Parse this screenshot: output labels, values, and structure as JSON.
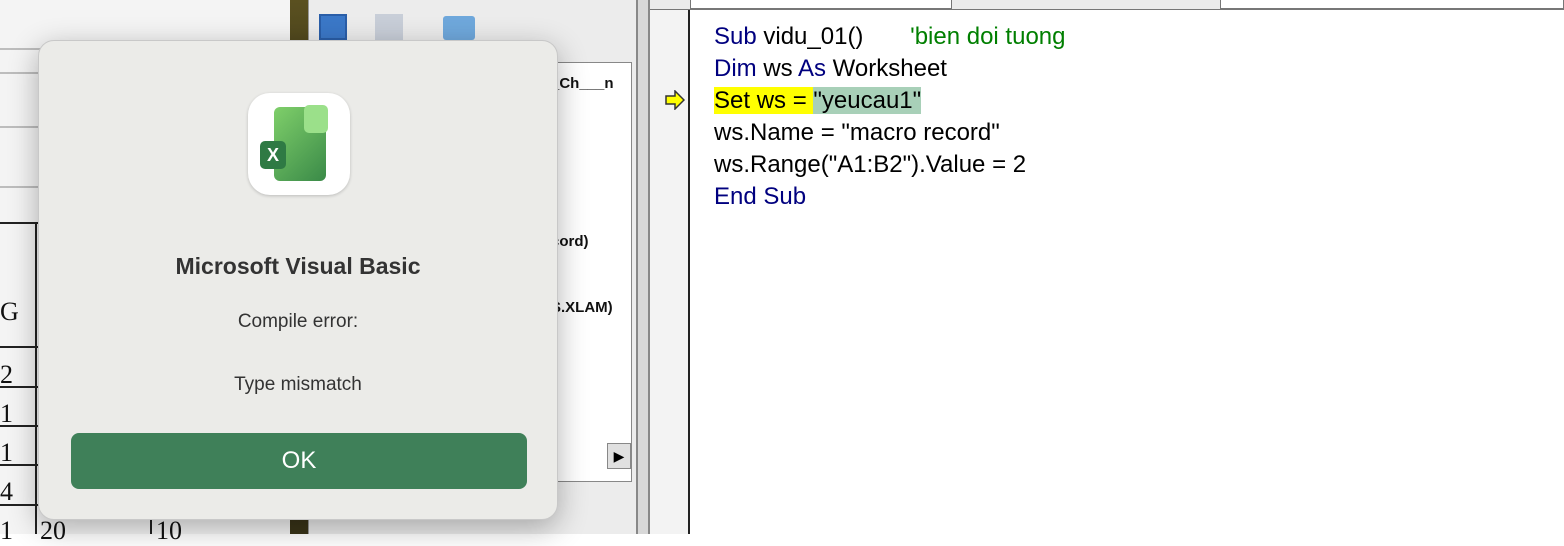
{
  "spreadsheet": {
    "column_header": "G",
    "cells": [
      "2",
      "1",
      "1",
      "4",
      "1",
      "20",
      "10"
    ]
  },
  "project_pane": {
    "items": [
      "_Ch___n",
      "cord)",
      "S.XLAM)"
    ]
  },
  "code": {
    "lines": [
      {
        "parts": [
          {
            "t": "Sub",
            "c": "kw"
          },
          {
            "t": " vidu_01()       ",
            "c": ""
          },
          {
            "t": "'bien doi tuong",
            "c": "cm"
          }
        ]
      },
      {
        "parts": [
          {
            "t": "Dim",
            "c": "kw"
          },
          {
            "t": " ws ",
            "c": ""
          },
          {
            "t": "As",
            "c": "kw"
          },
          {
            "t": " Worksheet",
            "c": ""
          }
        ]
      },
      {
        "parts": [
          {
            "t": "Set ws = ",
            "c": "yl"
          },
          {
            "t": "\"yeucau1\"",
            "c": "sel"
          }
        ]
      },
      {
        "parts": [
          {
            "t": "ws.Name = \"macro record\"",
            "c": ""
          }
        ]
      },
      {
        "parts": [
          {
            "t": "ws.Range(\"A1:B2\").Value = 2",
            "c": ""
          }
        ]
      },
      {
        "parts": [
          {
            "t": "End Sub",
            "c": "kw"
          }
        ]
      }
    ],
    "current_line": 3
  },
  "dialog": {
    "title": "Microsoft Visual Basic",
    "heading": "Compile error:",
    "message": "Type mismatch",
    "ok_label": "OK",
    "accent": "#3f8059"
  }
}
